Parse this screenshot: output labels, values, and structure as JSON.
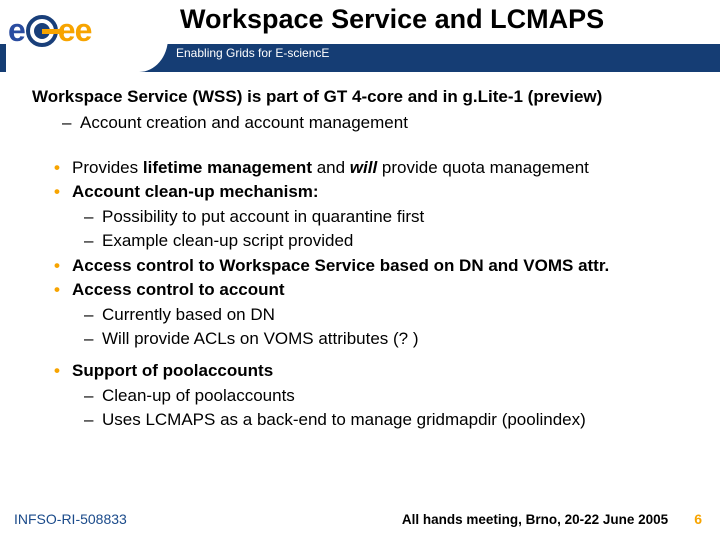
{
  "logo_text": {
    "e1": "e",
    "ee": "ee"
  },
  "title": "Workspace Service and LCMAPS",
  "tagline": "Enabling Grids for E-sciencE",
  "intro_prefix": "Workspace Service (WSS) is part of GT",
  "intro_gt": "4",
  "intro_mid": "-core and in g.Lite-1 (preview)",
  "intro_sub": "Account creation and account management",
  "b1_pre": "Provides ",
  "b1_strong": "lifetime management",
  "b1_mid": " and ",
  "b1_ital": "will",
  "b1_post": " provide quota management",
  "b2": "Account clean-up mechanism:",
  "b2_s1": "Possibility to put account in quarantine first",
  "b2_s2": "Example clean-up script provided",
  "b3": "Access control to Workspace Service based on DN and VOMS attr.",
  "b4": "Access control to account",
  "b4_s1": "Currently based on DN",
  "b4_s2": "Will provide ACLs on VOMS attributes (? )",
  "b5": "Support of poolaccounts",
  "b5_s1": "Clean-up of poolaccounts",
  "b5_s2": "Uses LCMAPS as a back-end to manage gridmapdir (poolindex)",
  "footer_left": "INFSO-RI-508833",
  "footer_right": "All hands meeting, Brno, 20-22 June 2005",
  "page_num": "6"
}
